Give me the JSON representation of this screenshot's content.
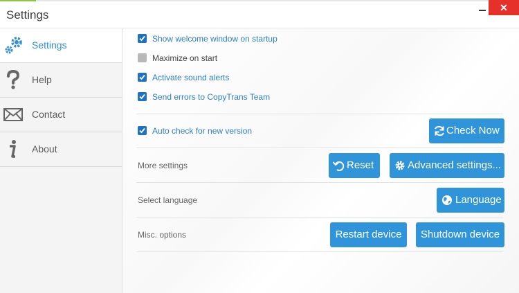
{
  "window": {
    "title": "Settings"
  },
  "sidebar": {
    "items": [
      {
        "label": "Settings",
        "icon": "gear-icon",
        "active": true
      },
      {
        "label": "Help",
        "icon": "question-icon",
        "active": false
      },
      {
        "label": "Contact",
        "icon": "envelope-icon",
        "active": false
      },
      {
        "label": "About",
        "icon": "info-icon",
        "active": false
      }
    ]
  },
  "options": {
    "show_welcome": {
      "label": "Show welcome window on startup",
      "checked": true
    },
    "maximize": {
      "label": "Maximize on start",
      "checked": false
    },
    "sound_alerts": {
      "label": "Activate sound alerts",
      "checked": true
    },
    "send_errors": {
      "label": "Send errors to CopyTrans Team",
      "checked": true
    },
    "auto_check": {
      "label": "Auto check for new version",
      "checked": true
    }
  },
  "sections": {
    "more_settings": "More settings",
    "select_language": "Select language",
    "misc_options": "Misc. options"
  },
  "buttons": {
    "check_now": "Check Now",
    "reset": "Reset",
    "advanced": "Advanced settings...",
    "language": "Language",
    "restart": "Restart device",
    "shutdown": "Shutdown device"
  },
  "colors": {
    "accent": "#2f94da",
    "active_text": "#2f8fd8",
    "checkbox": "#1d72c4",
    "close": "#e6312b"
  }
}
